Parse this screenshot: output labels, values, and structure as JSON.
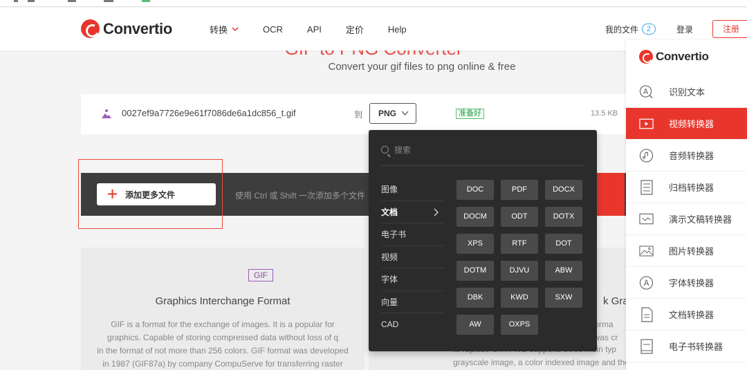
{
  "header": {
    "brand": "Convertio",
    "nav": [
      {
        "label": "转换",
        "has_dropdown": true
      },
      {
        "label": "OCR"
      },
      {
        "label": "API"
      },
      {
        "label": "定价"
      },
      {
        "label": "Help"
      }
    ],
    "my_files_label": "我的文件",
    "my_files_count": "2",
    "login_label": "登录",
    "register_label": "注册"
  },
  "hero": {
    "title": "GIF to PNG Converter",
    "subtitle": "Convert your gif files to png online & free"
  },
  "file": {
    "name": "0027ef9a7726e9e61f7086de6a1dc856_t.gif",
    "to_label": "到",
    "target_format": "PNG",
    "status": "准备好",
    "size": "13.5 KB"
  },
  "add_bar": {
    "button_label": "添加更多文件",
    "hint": "使用 Ctrl 或 Shift 一次添加多个文件"
  },
  "dropdown": {
    "search_placeholder": "搜索",
    "categories": [
      "图像",
      "文档",
      "电子书",
      "视频",
      "字体",
      "向量",
      "CAD"
    ],
    "active_category": "文档",
    "formats": [
      "DOC",
      "PDF",
      "DOCX",
      "DOCM",
      "ODT",
      "DOTX",
      "XPS",
      "RTF",
      "DOT",
      "DOTM",
      "DJVU",
      "ABW",
      "DBK",
      "KWD",
      "SXW",
      "AW",
      "OXPS"
    ]
  },
  "info_left": {
    "tag": "GIF",
    "title": "Graphics Interchange Format",
    "desc_lines": [
      "GIF is a format for the exchange of images. It is a popular for",
      "graphics. Capable of storing compressed data without loss of q",
      "in the format of not more than 256 colors. GIF format was developed",
      "in 1987 (GIF87a) by company CompuServe for transferring raster"
    ]
  },
  "info_right": {
    "title": "k Grap",
    "desc_lines": [
      "e forma",
      "G was cr",
      "to replace GIF. PNG supports three main typ"
    ],
    "bottom_line": "grayscale image, a color indexed image and the color image. PNG"
  },
  "sidebar": {
    "brand": "Convertio",
    "items": [
      {
        "label": "识别文本",
        "icon": "ocr-icon"
      },
      {
        "label": "视频转换器",
        "icon": "video-icon"
      },
      {
        "label": "音频转换器",
        "icon": "audio-icon"
      },
      {
        "label": "归档转换器",
        "icon": "archive-icon"
      },
      {
        "label": "演示文稿转换器",
        "icon": "presentation-icon"
      },
      {
        "label": "图片转换器",
        "icon": "image-icon"
      },
      {
        "label": "字体转换器",
        "icon": "font-icon"
      },
      {
        "label": "文档转换器",
        "icon": "document-icon"
      },
      {
        "label": "电子书转换器",
        "icon": "ebook-icon"
      }
    ],
    "active_index": 1
  },
  "colors": {
    "brand_red": "#e8362d",
    "dark_bar": "#3d3d3d",
    "dropdown_bg": "#2b2b2b",
    "status_green": "#2e9b47"
  }
}
